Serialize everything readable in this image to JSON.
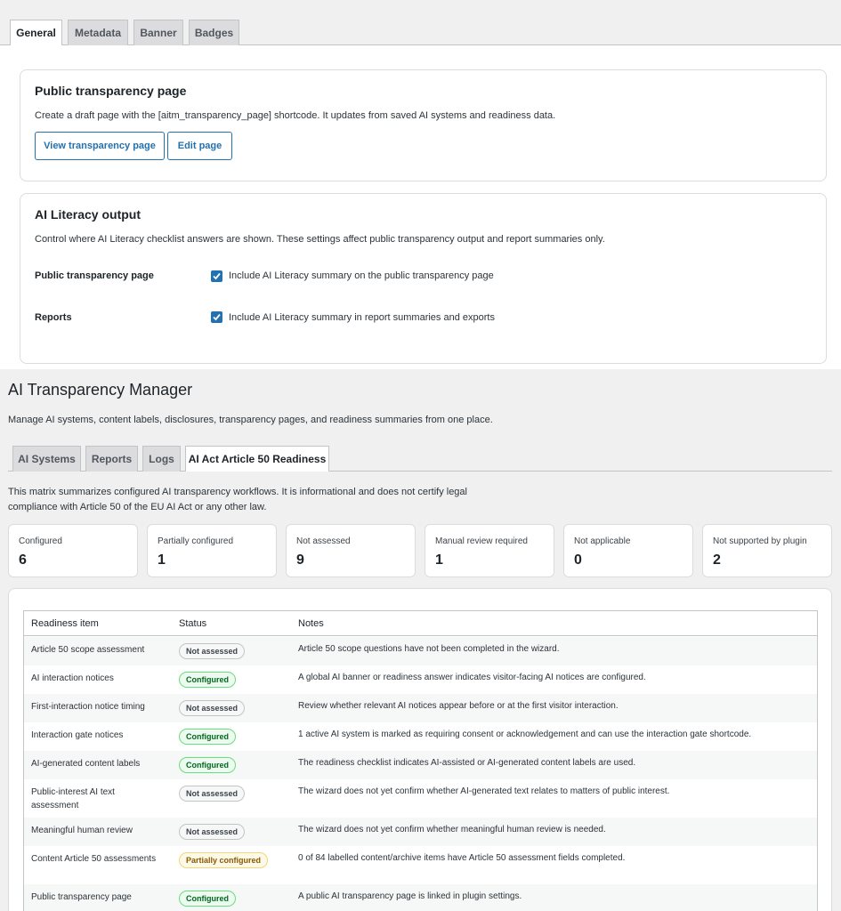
{
  "settings": {
    "tabs": [
      "General",
      "Metadata",
      "Banner",
      "Badges"
    ],
    "transparency_card": {
      "title": "Public transparency page",
      "description": "Create a draft page with the [aitm_transparency_page] shortcode. It updates from saved AI systems and readiness data.",
      "view_button": "View transparency page",
      "edit_button": "Edit page"
    },
    "literacy_card": {
      "title": "AI Literacy output",
      "description": "Control where AI Literacy checklist answers are shown. These settings affect public transparency output and report summaries only.",
      "rows": [
        {
          "label": "Public transparency page",
          "checkbox": "Include AI Literacy summary on the public transparency page",
          "checked": true
        },
        {
          "label": "Reports",
          "checkbox": "Include AI Literacy summary in report summaries and exports",
          "checked": true
        }
      ]
    }
  },
  "manager": {
    "title": "AI Transparency Manager",
    "subtitle": "Manage AI systems, content labels, disclosures, transparency pages, and readiness summaries from one place.",
    "tabs": [
      "AI Systems",
      "Reports",
      "Logs",
      "AI Act Article 50 Readiness"
    ],
    "intro": "This matrix summarizes configured AI transparency workflows. It is informational and does not certify legal compliance with Article 50 of the EU AI Act or any other law.",
    "stats": [
      {
        "label": "Configured",
        "value": "6"
      },
      {
        "label": "Partially configured",
        "value": "1"
      },
      {
        "label": "Not assessed",
        "value": "9"
      },
      {
        "label": "Manual review required",
        "value": "1"
      },
      {
        "label": "Not applicable",
        "value": "0"
      },
      {
        "label": "Not supported by plugin",
        "value": "2"
      }
    ],
    "table": {
      "headers": [
        "Readiness item",
        "Status",
        "Notes"
      ],
      "rows": [
        {
          "item": "Article 50 scope assessment",
          "status": "Not assessed",
          "kind": "na",
          "note": "Article 50 scope questions have not been completed in the wizard."
        },
        {
          "item": "AI interaction notices",
          "status": "Configured",
          "kind": "ok",
          "note": "A global AI banner or readiness answer indicates visitor-facing AI notices are configured."
        },
        {
          "item": "First-interaction notice timing",
          "status": "Not assessed",
          "kind": "na",
          "note": "Review whether relevant AI notices appear before or at the first visitor interaction."
        },
        {
          "item": "Interaction gate notices",
          "status": "Configured",
          "kind": "ok",
          "note": "1 active AI system is marked as requiring consent or acknowledgement and can use the interaction gate shortcode."
        },
        {
          "item": "AI-generated content labels",
          "status": "Configured",
          "kind": "ok",
          "note": "The readiness checklist indicates AI-assisted or AI-generated content labels are used."
        },
        {
          "item": "Public-interest AI text assessment",
          "status": "Not assessed",
          "kind": "na",
          "note": "The wizard does not yet confirm whether AI-generated text relates to matters of public interest."
        },
        {
          "item": "Meaningful human review",
          "status": "Not assessed",
          "kind": "na",
          "note": "The wizard does not yet confirm whether meaningful human review is needed."
        },
        {
          "item": "Content Article 50 assessments",
          "status": "Partially configured",
          "kind": "part",
          "note": "0 of 84 labelled content/archive items have Article 50 assessment fields completed."
        },
        {
          "item": "Public transparency page",
          "status": "Configured",
          "kind": "ok",
          "note": "A public AI transparency page is linked in plugin settings."
        }
      ]
    }
  }
}
